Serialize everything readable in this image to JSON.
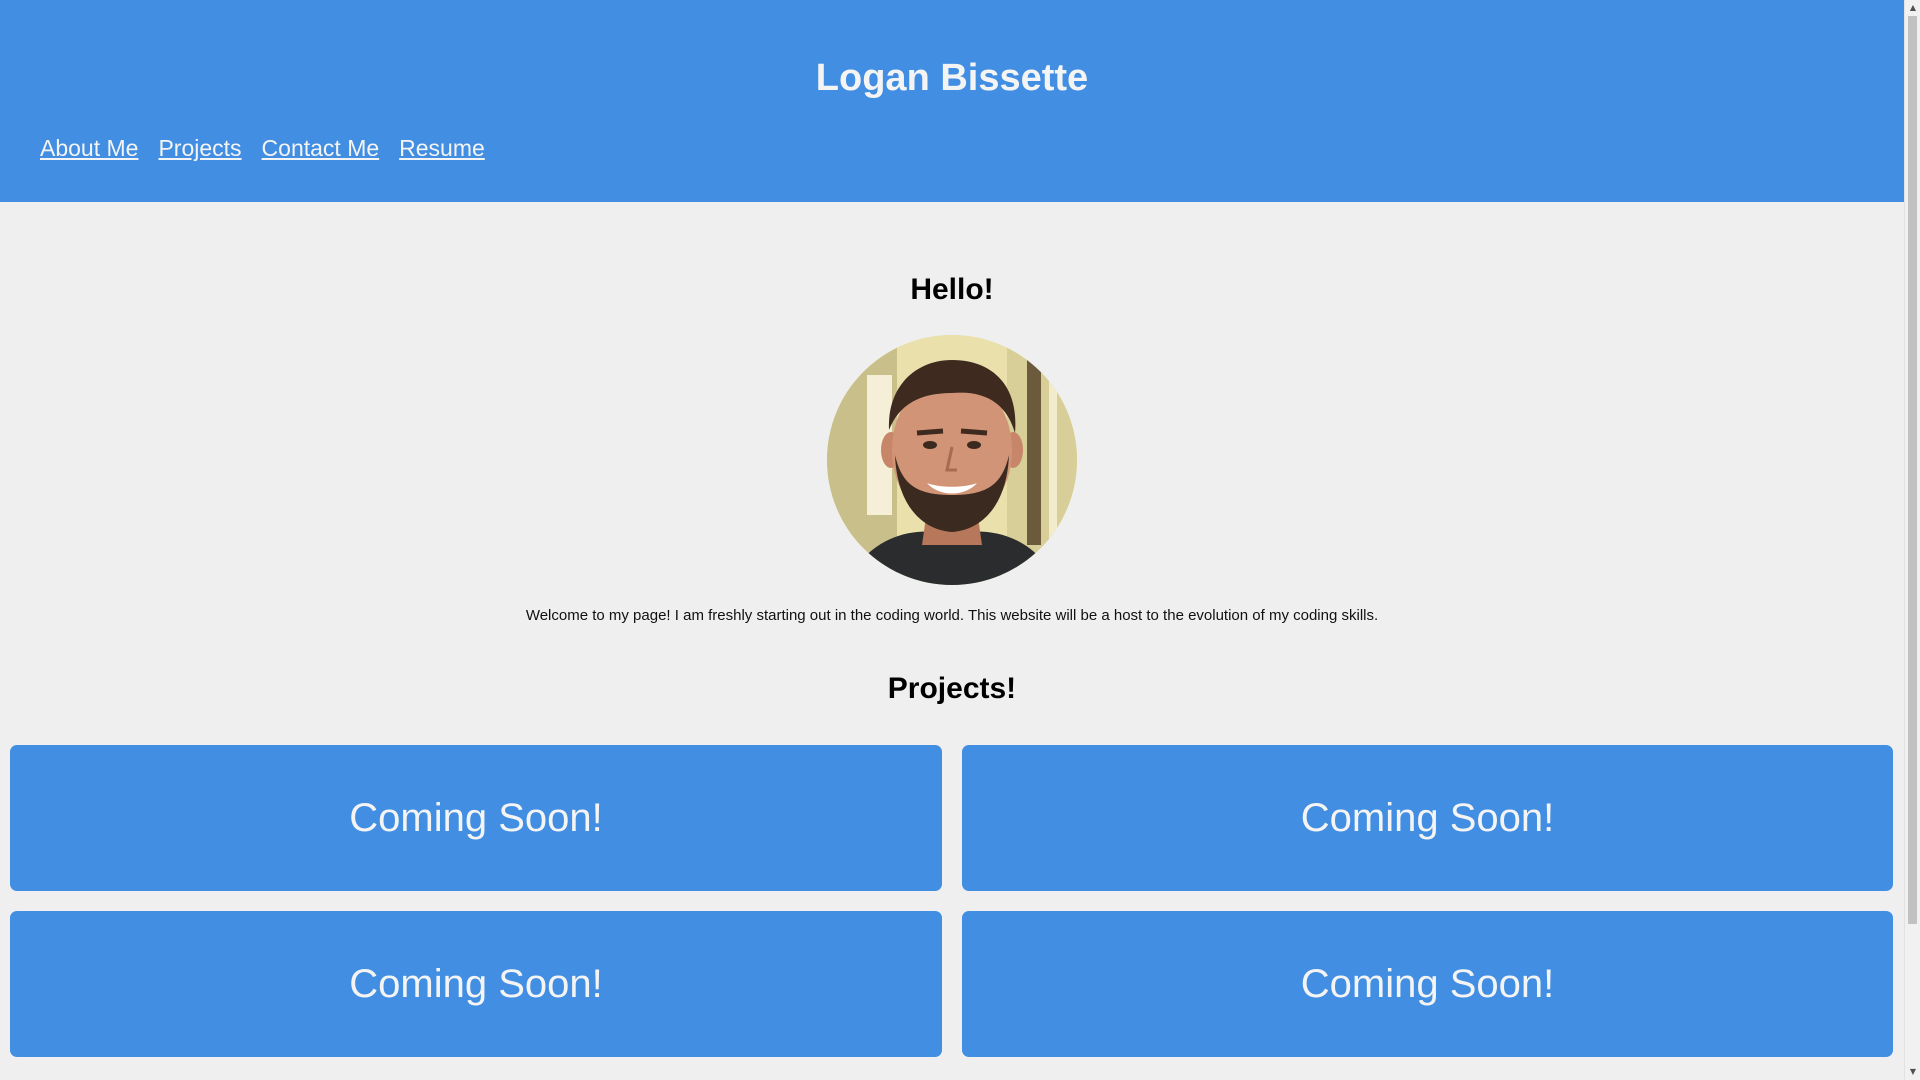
{
  "header": {
    "title": "Logan Bissette",
    "nav": [
      {
        "label": "About Me"
      },
      {
        "label": "Projects"
      },
      {
        "label": "Contact Me"
      },
      {
        "label": "Resume"
      }
    ]
  },
  "main": {
    "hello_heading": "Hello!",
    "intro_text": "Welcome to my page! I am freshly starting out in the coding world. This website will be a host to the evolution of my coding skills.",
    "projects_heading": "Projects!",
    "cards": [
      {
        "label": "Coming Soon!"
      },
      {
        "label": "Coming Soon!"
      },
      {
        "label": "Coming Soon!"
      },
      {
        "label": "Coming Soon!"
      }
    ]
  },
  "colors": {
    "brand": "#418ee2",
    "background": "#efefef",
    "header_text": "#f4f4f4"
  },
  "icons": {
    "scroll_up": "chevron-up-icon",
    "scroll_down": "chevron-down-icon"
  }
}
